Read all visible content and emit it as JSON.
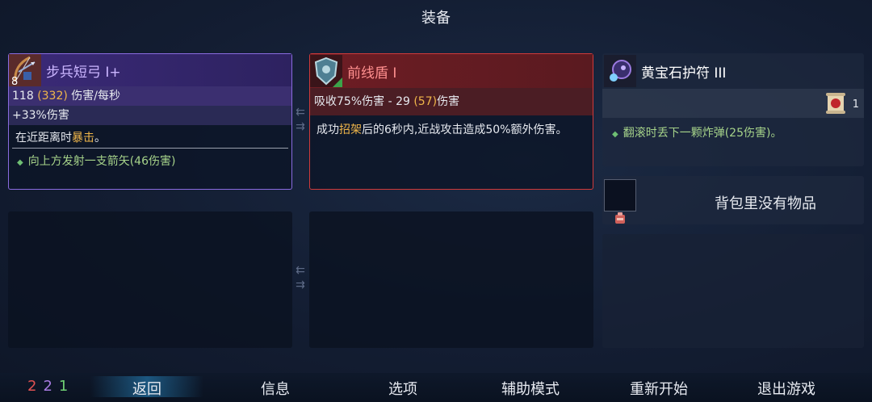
{
  "screen_title": "装备",
  "weapon": {
    "name": "步兵短弓 I+",
    "level": "8",
    "dps_base": "118",
    "dps_bonus": "(332)",
    "dps_unit": "伤害/每秒",
    "bonus": "+33%伤害",
    "effect_prefix": "在近距离时",
    "effect_highlight": "暴击",
    "effect_suffix": "。",
    "sub_effect": "向上方发射一支箭矢(46伤害)",
    "colors": {
      "border": "#8a6be0",
      "highlight": "#f0b64a"
    },
    "icon": "bow-icon"
  },
  "shield": {
    "name": "前线盾 I",
    "stat_prefix": "吸收75%伤害 - 29",
    "stat_bonus": "(57)",
    "stat_suffix": "伤害",
    "desc_prefix": "成功",
    "desc_highlight": "招架",
    "desc_suffix": "后的6秒内,近战攻击造成50%额外伤害。",
    "colors": {
      "border": "#d03a3a"
    },
    "icon": "shield-icon"
  },
  "amulet": {
    "name": "黄宝石护符 III",
    "scroll_count": "1",
    "sub_effect": "翻滚时丢下一颗炸弹(25伤害)。",
    "icon": "amulet-icon"
  },
  "backpack": {
    "empty_text": "背包里没有物品"
  },
  "counters": {
    "red": "2",
    "purple": "2",
    "green": "1",
    "colors": {
      "red": "#e05252",
      "purple": "#a77be0",
      "green": "#6fcf73"
    }
  },
  "menu": {
    "back": "返回",
    "info": "信息",
    "options": "选项",
    "assist": "辅助模式",
    "restart": "重新开始",
    "quit": "退出游戏"
  }
}
